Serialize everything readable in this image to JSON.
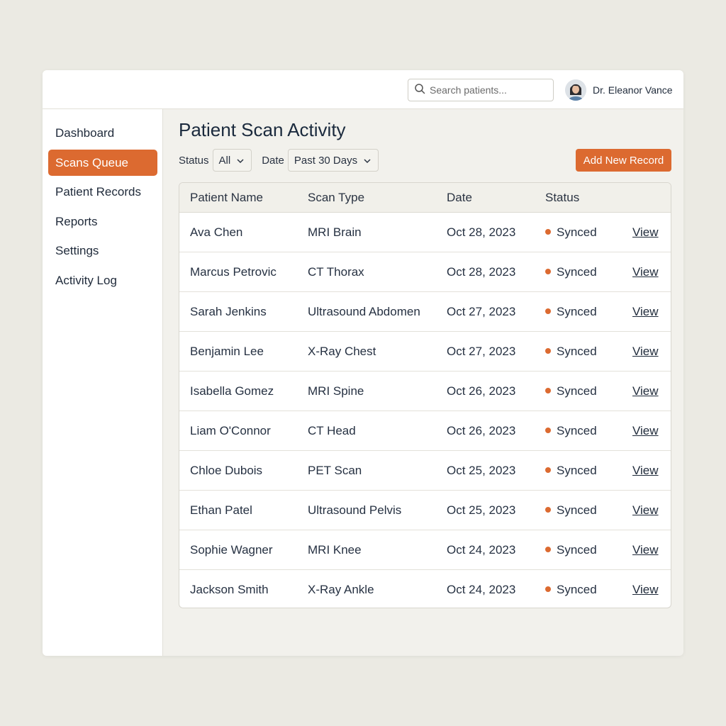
{
  "header": {
    "search_placeholder": "Search patients...",
    "user_name": "Dr. Eleanor Vance"
  },
  "sidebar": {
    "items": [
      {
        "label": "Dashboard",
        "active": false
      },
      {
        "label": "Scans Queue",
        "active": true
      },
      {
        "label": "Patient Records",
        "active": false
      },
      {
        "label": "Reports",
        "active": false
      },
      {
        "label": "Settings",
        "active": false
      },
      {
        "label": "Activity Log",
        "active": false
      }
    ]
  },
  "main": {
    "title": "Patient Scan Activity",
    "filters": {
      "status_label": "Status",
      "status_value": "All",
      "date_label": "Date",
      "date_value": "Past 30 Days"
    },
    "add_button": "Add New Record"
  },
  "table": {
    "headers": [
      "Patient Name",
      "Scan Type",
      "Date",
      "Status"
    ],
    "rows": [
      {
        "name": "Ava Chen",
        "scan": "MRI Brain",
        "date": "Oct 28, 2023",
        "status": "Synced",
        "action": "View"
      },
      {
        "name": "Marcus Petrovic",
        "scan": "CT Thorax",
        "date": "Oct 28, 2023",
        "status": "Synced",
        "action": "View"
      },
      {
        "name": "Sarah Jenkins",
        "scan": "Ultrasound Abdomen",
        "date": "Oct 27, 2023",
        "status": "Synced",
        "action": "View"
      },
      {
        "name": "Benjamin Lee",
        "scan": "X-Ray Chest",
        "date": "Oct 27, 2023",
        "status": "Synced",
        "action": "View"
      },
      {
        "name": "Isabella Gomez",
        "scan": "MRI Spine",
        "date": "Oct 26, 2023",
        "status": "Synced",
        "action": "View"
      },
      {
        "name": "Liam O'Connor",
        "scan": "CT Head",
        "date": "Oct 26, 2023",
        "status": "Synced",
        "action": "View"
      },
      {
        "name": "Chloe Dubois",
        "scan": "PET Scan",
        "date": "Oct 25, 2023",
        "status": "Synced",
        "action": "View"
      },
      {
        "name": "Ethan Patel",
        "scan": "Ultrasound Pelvis",
        "date": "Oct 25, 2023",
        "status": "Synced",
        "action": "View"
      },
      {
        "name": "Sophie Wagner",
        "scan": "MRI Knee",
        "date": "Oct 24, 2023",
        "status": "Synced",
        "action": "View"
      },
      {
        "name": "Jackson Smith",
        "scan": "X-Ray Ankle",
        "date": "Oct 24, 2023",
        "status": "Synced",
        "action": "View"
      }
    ]
  },
  "colors": {
    "accent": "#dc6a30",
    "background": "#ebeae3",
    "text": "#1f2a3a"
  },
  "icons": {
    "search": "search-icon",
    "avatar": "user-avatar",
    "chevron": "chevron-down-icon",
    "status": "status-dot"
  }
}
